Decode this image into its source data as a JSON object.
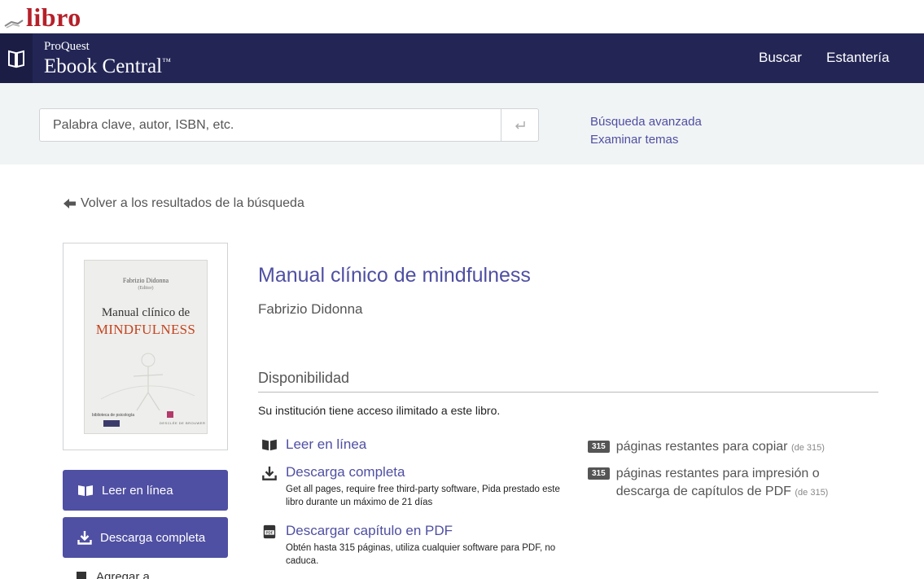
{
  "brand_banner": {
    "text": "libro",
    "color": "#b5202a"
  },
  "navbar": {
    "brand_small": "ProQuest",
    "brand_big": "Ebook Central",
    "trademark": "™",
    "links": [
      "Buscar",
      "Estantería"
    ],
    "background": "#232655"
  },
  "search": {
    "placeholder": "Palabra clave, autor, ISBN, etc.",
    "advanced_link": "Búsqueda avanzada",
    "browse_link": "Examinar temas"
  },
  "back_link": "Volver a los resultados de la búsqueda",
  "cover": {
    "author": "Fabrizio Didonna",
    "editor": "(Editor)",
    "title_line1": "Manual clínico de",
    "title_line2": "MINDFULNESS",
    "series": "biblioteca de psicología",
    "publisher": "DESCLÉE DE BROUWER"
  },
  "side_buttons": {
    "read_online": "Leer en línea",
    "full_download": "Descarga completa",
    "partial_label": "Agregar a..."
  },
  "book": {
    "title": "Manual clínico de mindfulness",
    "author": "Fabrizio Didonna"
  },
  "availability": {
    "heading": "Disponibilidad",
    "note": "Su institución tiene acceso ilimitado a este libro.",
    "actions": [
      {
        "label": "Leer en línea",
        "icon": "book-open-icon",
        "desc": ""
      },
      {
        "label": "Descarga completa",
        "icon": "download-icon",
        "desc": "Get all pages, require free third-party software, Pida prestado este libro durante un máximo de 21 días"
      },
      {
        "label": "Descargar capítulo en PDF",
        "icon": "pdf-icon",
        "desc": "Obtén hasta 315 páginas, utiliza cualquier software para PDF, no caduca."
      }
    ],
    "quotas": [
      {
        "count": "315",
        "text": "páginas restantes para copiar",
        "of": "(de 315)"
      },
      {
        "count": "315",
        "text": "páginas restantes para impresión o descarga de capítulos de PDF",
        "of": "(de 315)"
      }
    ]
  },
  "accent_color": "#4f4fa3"
}
